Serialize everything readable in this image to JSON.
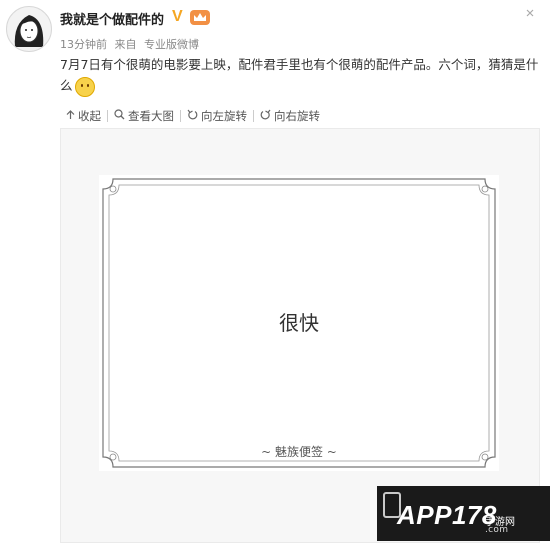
{
  "post": {
    "author": "我就是个做配件的",
    "verified_badge": "V",
    "meta_time": "13分钟前",
    "meta_source_prefix": "来自",
    "meta_source": "专业版微博",
    "content_text": "7月7日有个很萌的电影要上映，配件君手里也有个很萌的配件产品。六个词，猜猜是什么"
  },
  "toolbar": {
    "collapse_label": "收起",
    "view_large_label": "查看大图",
    "rotate_left_label": "向左旋转",
    "rotate_right_label": "向右旋转"
  },
  "image": {
    "card_text": "很快",
    "card_brand": "~ 魅族便签 ~"
  },
  "watermark": {
    "logo_text": "APP178",
    "sub_text": "手游网",
    "site": ".com"
  },
  "colors": {
    "vip_badge": "#f29044",
    "verified": "#f5a623"
  },
  "icons": {
    "collapse": "arrow-up-icon",
    "view_large": "magnifier-icon",
    "rotate_left": "rotate-left-icon",
    "rotate_right": "rotate-right-icon"
  }
}
